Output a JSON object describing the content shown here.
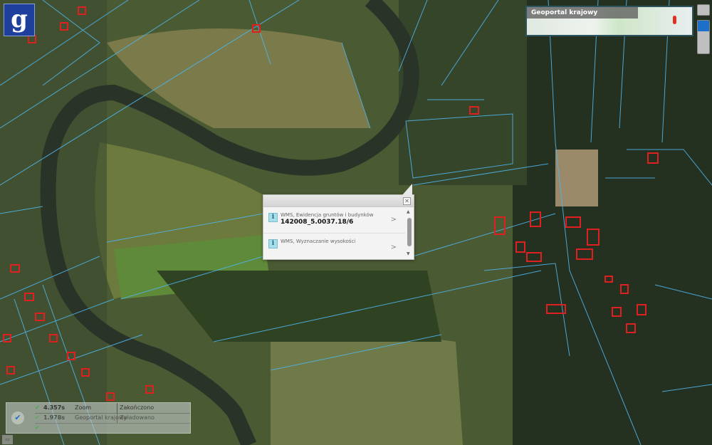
{
  "logo": {
    "letter": "g"
  },
  "overview": {
    "label": "Geoportal krajowy"
  },
  "layer_controls": [
    {
      "name": "layer-switch-icon"
    },
    {
      "name": "zoom-in-icon"
    },
    {
      "name": "zoom-out-icon"
    }
  ],
  "popup": {
    "close": "✕",
    "results": [
      {
        "source": "WMS, Ewidencja gruntów i budynków",
        "value": "142008_5.0037.18/6"
      },
      {
        "source": "WMS, Wyznaczanie wysokości",
        "value": ""
      }
    ]
  },
  "status": {
    "rows": [
      {
        "time": "4.357s",
        "name": "Zoom",
        "state": "Zakończono"
      },
      {
        "time": "1.978s",
        "name": "Geoportal krajowy",
        "state": "Załadowano"
      },
      {
        "time": "",
        "name": "",
        "state": ""
      }
    ]
  },
  "colors": {
    "parcel": "#4fb3e8",
    "building": "#e02020",
    "logo_bg": "#1f3f9c"
  }
}
